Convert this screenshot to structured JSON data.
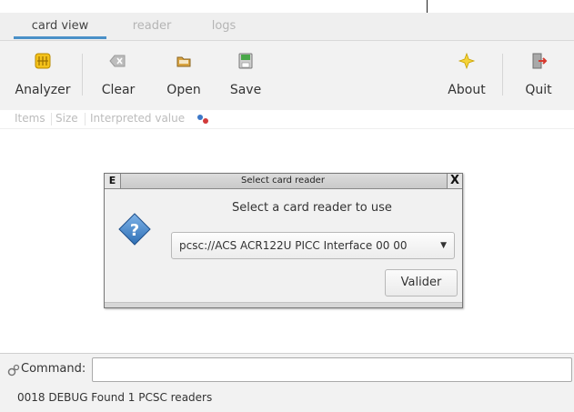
{
  "tabs": [
    {
      "label": "card view",
      "active": true
    },
    {
      "label": "reader",
      "active": false
    },
    {
      "label": "logs",
      "active": false
    }
  ],
  "toolbar": {
    "analyzer": {
      "label": "Analyzer",
      "icon": "sim-card-icon"
    },
    "clear": {
      "label": "Clear",
      "icon": "clear-icon"
    },
    "open": {
      "label": "Open",
      "icon": "folder-open-icon"
    },
    "save": {
      "label": "Save",
      "icon": "save-icon"
    },
    "about": {
      "label": "About",
      "icon": "star-icon"
    },
    "quit": {
      "label": "Quit",
      "icon": "exit-door-icon"
    }
  },
  "columns": {
    "items": "Items",
    "size": "Size",
    "interpreted": "Interpreted value"
  },
  "dialog": {
    "e_label": "E",
    "title": "Select card reader",
    "close": "X",
    "prompt": "Select a card reader to use",
    "selected_reader": "pcsc://ACS ACR122U PICC Interface 00 00",
    "button": "Valider"
  },
  "command": {
    "label": "Command:",
    "value": ""
  },
  "log": {
    "line": "0018 DEBUG  Found 1 PCSC readers"
  },
  "colors": {
    "tab_accent": "#4a90c8",
    "question_icon": "#2e6fb5",
    "analyzer_icon": "#e8b700"
  }
}
